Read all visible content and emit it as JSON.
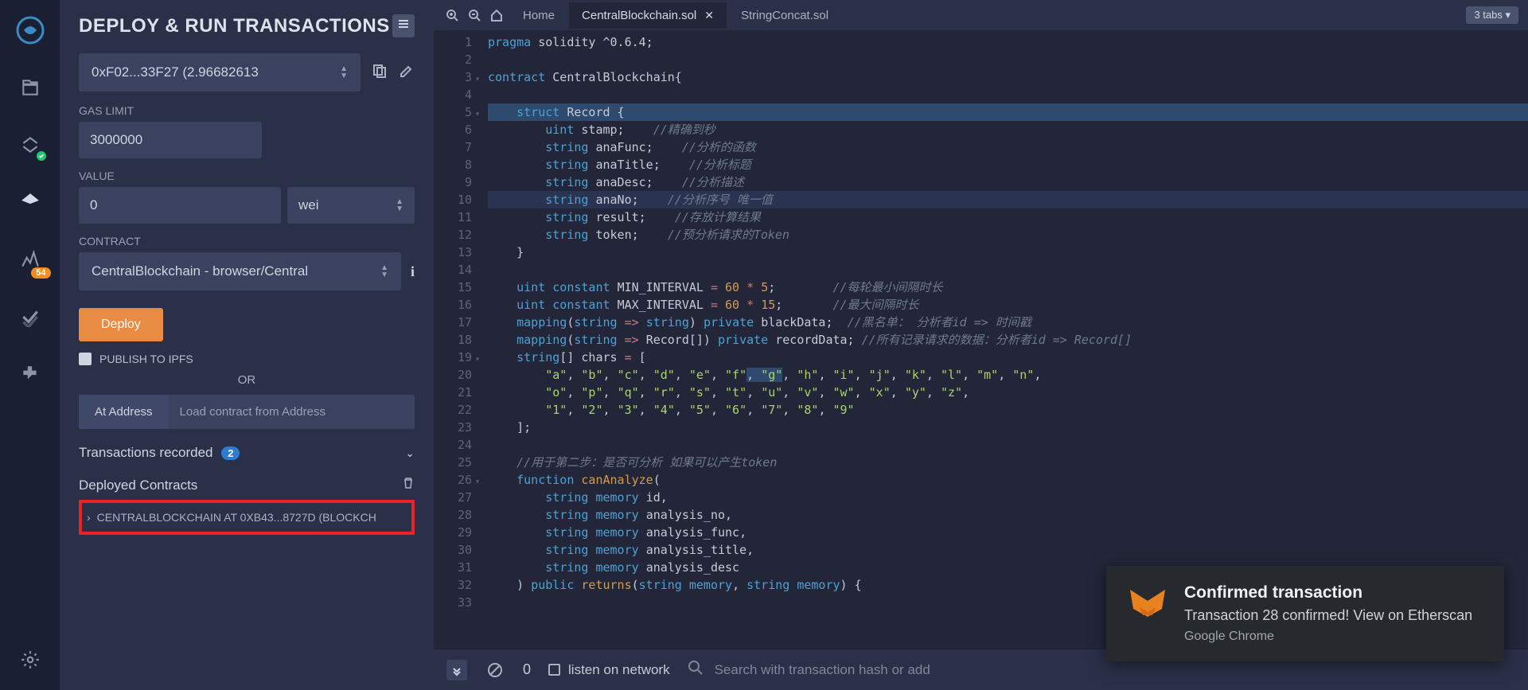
{
  "panel": {
    "title": "DEPLOY & RUN TRANSACTIONS",
    "account": "0xF02...33F27 (2.96682613",
    "gas_label": "GAS LIMIT",
    "gas_value": "3000000",
    "value_label": "VALUE",
    "value_amount": "0",
    "value_unit": "wei",
    "contract_label": "CONTRACT",
    "contract_value": "CentralBlockchain - browser/Central",
    "deploy": "Deploy",
    "publish": "PUBLISH TO IPFS",
    "or": "OR",
    "at_address": "At Address",
    "at_address_placeholder": "Load contract from Address",
    "tx_recorded": "Transactions recorded",
    "tx_count": "2",
    "deployed_title": "Deployed Contracts",
    "deployed_item": "CENTRALBLOCKCHAIN AT 0XB43...8727D (BLOCKCH"
  },
  "tabs": {
    "home": "Home",
    "file1": "CentralBlockchain.sol",
    "file2": "StringConcat.sol",
    "count": "3 tabs"
  },
  "badge_count": "54",
  "terminal": {
    "count": "0",
    "listen": "listen on network",
    "search_placeholder": "Search with transaction hash or add"
  },
  "toast": {
    "title": "Confirmed transaction",
    "msg": "Transaction 28 confirmed! View on Etherscan",
    "app": "Google Chrome"
  },
  "code": [
    {
      "n": 1,
      "h": "pragma",
      "r": " solidity ^0.6.4;"
    },
    {
      "n": 2,
      "h": "",
      "r": ""
    },
    {
      "n": 3,
      "h": "contract",
      "r": " CentralBlockchain{"
    },
    {
      "n": 4,
      "h": "",
      "r": ""
    },
    {
      "n": 5,
      "h": "struct",
      "r": " Record {",
      "cls": "hl"
    },
    {
      "n": 6,
      "h": "uint",
      "r": " stamp;",
      "c": "//精确到秒"
    },
    {
      "n": 7,
      "h": "string",
      "r": " anaFunc;",
      "c": "//分析的函数"
    },
    {
      "n": 8,
      "h": "string",
      "r": " anaTitle;",
      "c": "//分析标题"
    },
    {
      "n": 9,
      "h": "string",
      "r": " anaDesc;",
      "c": "//分析描述"
    },
    {
      "n": 10,
      "h": "string",
      "r": " anaNo;",
      "c": "//分析序号 唯一值",
      "cls": "hl2"
    },
    {
      "n": 11,
      "h": "string",
      "r": " result;",
      "c": "//存放计算结果"
    },
    {
      "n": 12,
      "h": "string",
      "r": " token;",
      "c": "//预分析请求的Token"
    },
    {
      "n": 13,
      "h": "",
      "r": "}"
    },
    {
      "n": 14,
      "h": "",
      "r": ""
    }
  ]
}
